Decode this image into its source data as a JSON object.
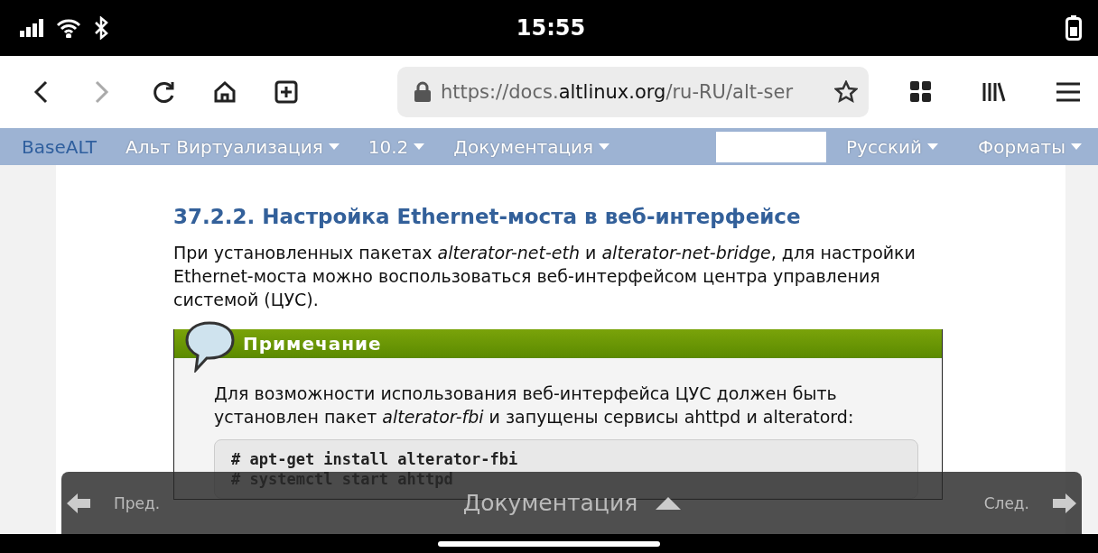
{
  "status_bar": {
    "time": "15:55"
  },
  "browser": {
    "url": {
      "prefix": "https://docs.",
      "domain": "altlinux.org",
      "path": "/ru-RU/alt-ser"
    }
  },
  "site_nav": {
    "brand": "BaseALT",
    "menus": [
      "Альт Виртуализация",
      "10.2",
      "Документация"
    ],
    "right_menus": [
      "Русский",
      "Форматы"
    ]
  },
  "article": {
    "heading": "37.2.2. Настройка Ethernet-моста в веб-интерфейсе",
    "paragraph": "При установленных пакетах *alterator-net-eth* и *alterator-net-bridge*, для настройки Ethernet-моста можно воспользоваться веб-интерфейсом центра управления системой (ЦУС).",
    "note": {
      "title": "Примечание",
      "text": "Для возможности использования веб-интерфейса ЦУС должен быть установлен пакет *alterator-fbi* и запущены сервисы ahttpd и alteratord:",
      "code": [
        "# apt-get install alterator-fbi",
        "# systemctl start ahttpd"
      ]
    }
  },
  "footer_nav": {
    "prev": "Пред.",
    "center": "Документация",
    "next": "След."
  }
}
